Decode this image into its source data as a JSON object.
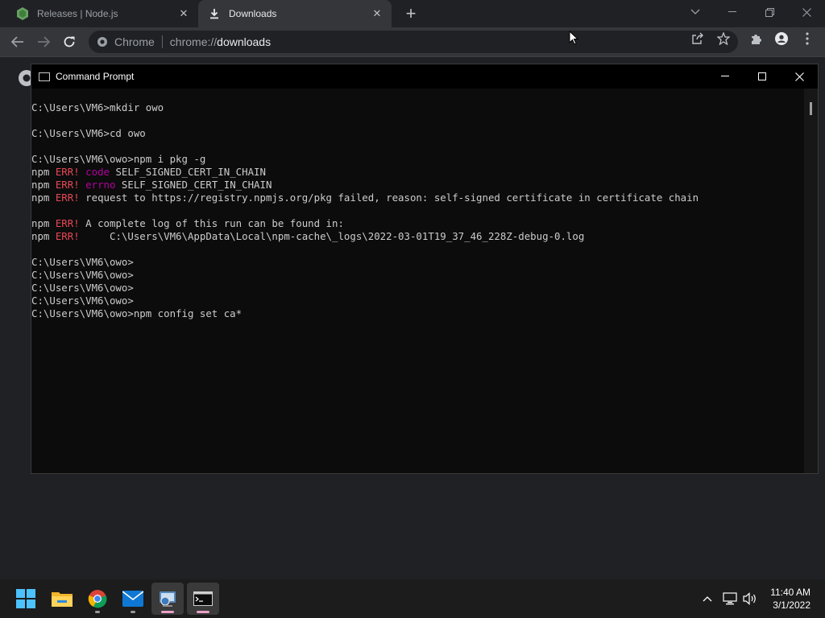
{
  "browser": {
    "tabs": [
      {
        "title": "Releases | Node.js",
        "icon": "nodejs-icon",
        "active": false
      },
      {
        "title": "Downloads",
        "icon": "download-icon",
        "active": true
      }
    ],
    "omnibox": {
      "site_name": "Chrome",
      "url_scheme": "chrome://",
      "url_host": "downloads"
    }
  },
  "cmd": {
    "title": "Command Prompt",
    "lines": [
      {
        "segments": [
          {
            "text": "C:\\Users\\VM6>mkdir owo",
            "style": "normal"
          }
        ]
      },
      {
        "segments": []
      },
      {
        "segments": [
          {
            "text": "C:\\Users\\VM6>cd owo",
            "style": "normal"
          }
        ]
      },
      {
        "segments": []
      },
      {
        "segments": [
          {
            "text": "C:\\Users\\VM6\\owo>npm i pkg -g",
            "style": "normal"
          }
        ]
      },
      {
        "segments": [
          {
            "text": "npm ",
            "style": "normal"
          },
          {
            "text": "ERR!",
            "style": "err"
          },
          {
            "text": " ",
            "style": "normal"
          },
          {
            "text": "code",
            "style": "key"
          },
          {
            "text": " SELF_SIGNED_CERT_IN_CHAIN",
            "style": "normal"
          }
        ]
      },
      {
        "segments": [
          {
            "text": "npm ",
            "style": "normal"
          },
          {
            "text": "ERR!",
            "style": "err"
          },
          {
            "text": " ",
            "style": "normal"
          },
          {
            "text": "errno",
            "style": "key"
          },
          {
            "text": " SELF_SIGNED_CERT_IN_CHAIN",
            "style": "normal"
          }
        ]
      },
      {
        "segments": [
          {
            "text": "npm ",
            "style": "normal"
          },
          {
            "text": "ERR!",
            "style": "err"
          },
          {
            "text": " request to https://registry.npmjs.org/pkg failed, reason: self-signed certificate in certificate chain",
            "style": "normal"
          }
        ]
      },
      {
        "segments": []
      },
      {
        "segments": [
          {
            "text": "npm ",
            "style": "normal"
          },
          {
            "text": "ERR!",
            "style": "err"
          },
          {
            "text": " A complete log of this run can be found in:",
            "style": "normal"
          }
        ]
      },
      {
        "segments": [
          {
            "text": "npm ",
            "style": "normal"
          },
          {
            "text": "ERR!",
            "style": "err"
          },
          {
            "text": "     C:\\Users\\VM6\\AppData\\Local\\npm-cache\\_logs\\2022-03-01T19_37_46_228Z-debug-0.log",
            "style": "normal"
          }
        ]
      },
      {
        "segments": []
      },
      {
        "segments": [
          {
            "text": "C:\\Users\\VM6\\owo>",
            "style": "normal"
          }
        ]
      },
      {
        "segments": [
          {
            "text": "C:\\Users\\VM6\\owo>",
            "style": "normal"
          }
        ]
      },
      {
        "segments": [
          {
            "text": "C:\\Users\\VM6\\owo>",
            "style": "normal"
          }
        ]
      },
      {
        "segments": [
          {
            "text": "C:\\Users\\VM6\\owo>",
            "style": "normal"
          }
        ]
      },
      {
        "segments": [
          {
            "text": "C:\\Users\\VM6\\owo>npm config set ca*",
            "style": "normal"
          }
        ]
      }
    ]
  },
  "taskbar": {
    "apps": [
      "start-icon",
      "file-explorer-icon",
      "chrome-icon",
      "mail-icon",
      "control-panel-icon",
      "command-prompt-icon"
    ],
    "time": "11:40 AM",
    "date": "3/1/2022"
  },
  "colors": {
    "err": "#e74856",
    "key": "#b4009e",
    "console_text": "#cccccc"
  }
}
